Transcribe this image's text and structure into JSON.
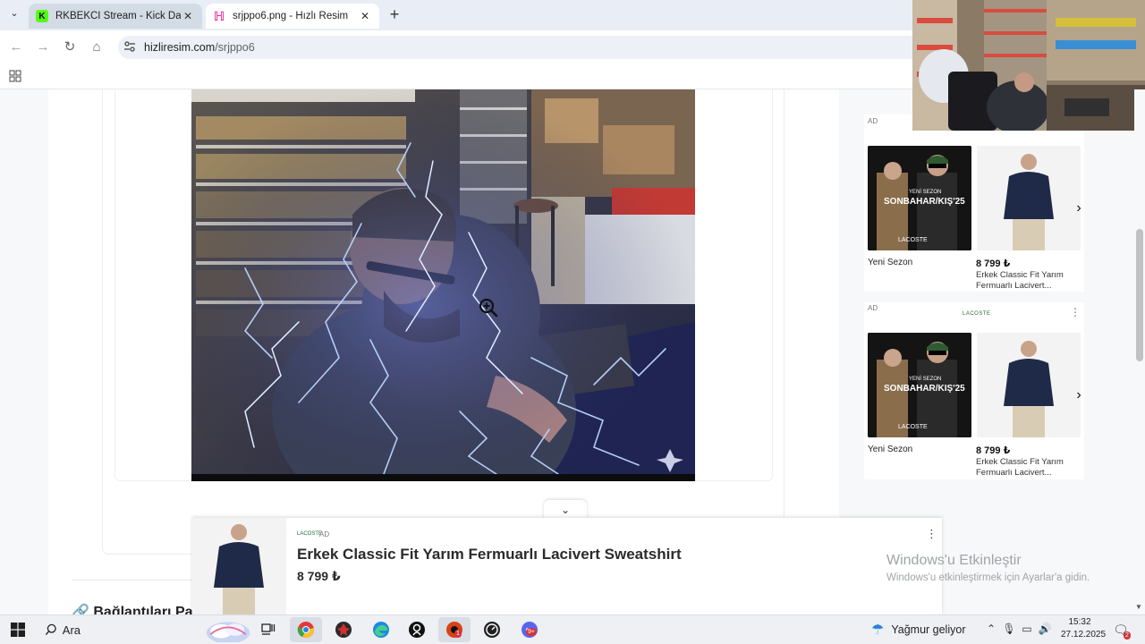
{
  "browser": {
    "tabs": [
      {
        "label": "RKBEKCI Stream - Kick Dashboard",
        "favicon": "kick-icon",
        "active": false
      },
      {
        "label": "srjppo6.png - Hızlı Resim",
        "favicon": "hizliresim-icon",
        "active": true
      }
    ],
    "url": {
      "domain": "hizliresim.com",
      "path": "/srjppo6"
    },
    "tab_close_glyph": "✕",
    "new_tab_glyph": "+",
    "tab_menu_glyph": "⌄"
  },
  "page": {
    "section_heading": "🔗 Bağlantıları Pa"
  },
  "ads": {
    "tag": "AD",
    "brand": "LACOSTE",
    "blocks": [
      {
        "left_caption": "Yeni Sezon",
        "promo_text": "YENİ SEZON",
        "promo_headline": "SONBAHAR/KIŞ'25",
        "price": "8 799 ₺",
        "product_title": "Erkek Classic Fit Yarım Fermuarlı Lacivert..."
      },
      {
        "left_caption": "Yeni Sezon",
        "promo_text": "YENİ SEZON",
        "promo_headline": "SONBAHAR/KIŞ'25",
        "price": "8 799 ₺",
        "product_title": "Erkek Classic Fit Yarım Fermuarlı Lacivert..."
      }
    ],
    "sticky": {
      "title": "Erkek Classic Fit Yarım Fermuarlı Lacivert Sweatshirt",
      "price": "8 799 ₺",
      "toggle_glyph": "⌄"
    }
  },
  "windows": {
    "activate_title": "Windows'u Etkinleştir",
    "activate_sub": "Windows'u etkinleştirmek için Ayarlar'a gidin."
  },
  "taskbar": {
    "search_label": "Ara",
    "weather": "Yağmur geliyor",
    "time": "15:32",
    "date": "27.12.2025",
    "notification_count": "2",
    "app_badge_1": "1",
    "app_badge_2": "9+"
  },
  "colors": {
    "kick_green": "#53fc18",
    "hizliresim_pink": "#e0138c",
    "chrome_tab_strip": "#e9eef6",
    "lightning": "#bcd4ff"
  }
}
